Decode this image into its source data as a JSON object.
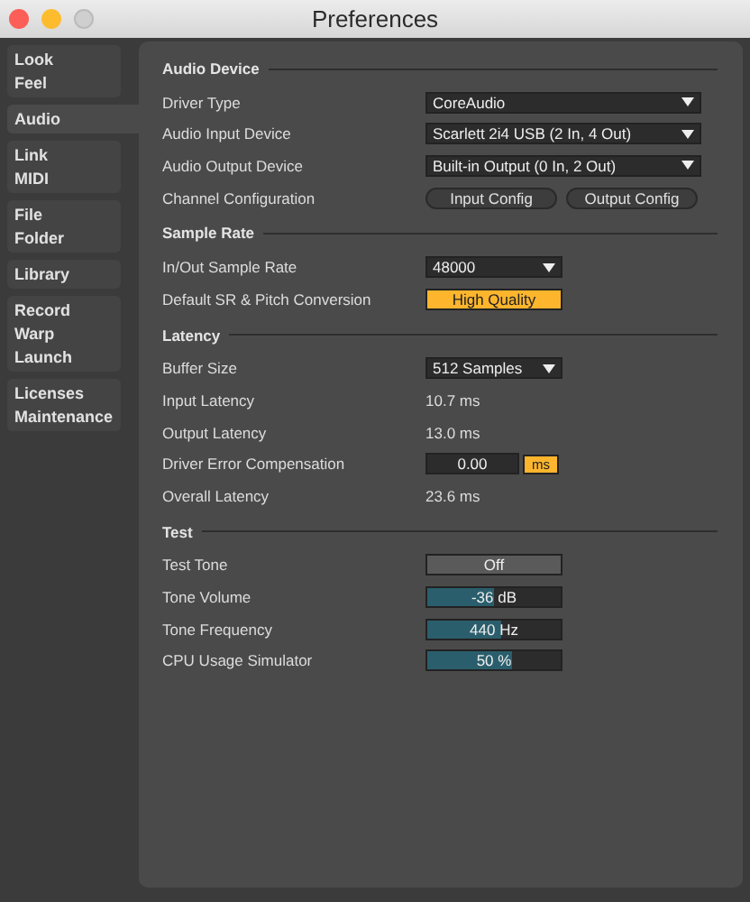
{
  "window": {
    "title": "Preferences"
  },
  "sidebar": {
    "groups": [
      {
        "items": [
          "Look",
          "Feel"
        ],
        "selected": false
      },
      {
        "items": [
          "Audio"
        ],
        "selected": true
      },
      {
        "items": [
          "Link",
          "MIDI"
        ],
        "selected": false
      },
      {
        "items": [
          "File",
          "Folder"
        ],
        "selected": false
      },
      {
        "items": [
          "Library"
        ],
        "selected": false
      },
      {
        "items": [
          "Record",
          "Warp",
          "Launch"
        ],
        "selected": false
      },
      {
        "items": [
          "Licenses",
          "Maintenance"
        ],
        "selected": false
      }
    ]
  },
  "sections": [
    {
      "title": "Audio Device",
      "rows": [
        {
          "kind": "dropdown",
          "label": "Driver Type",
          "value": "CoreAudio",
          "wide": true
        },
        {
          "kind": "dropdown",
          "label": "Audio Input Device",
          "value": "Scarlett 2i4 USB (2 In, 4 Out)",
          "wide": true
        },
        {
          "kind": "dropdown",
          "label": "Audio Output Device",
          "value": "Built-in Output (0 In, 2 Out)",
          "wide": true
        },
        {
          "kind": "buttons",
          "label": "Channel Configuration",
          "buttons": [
            "Input Config",
            "Output Config"
          ]
        }
      ]
    },
    {
      "title": "Sample Rate",
      "rows": [
        {
          "kind": "dropdown",
          "label": "In/Out Sample Rate",
          "value": "48000",
          "wide": false
        },
        {
          "kind": "toggle",
          "label": "Default SR & Pitch Conversion",
          "value": "High Quality",
          "on": true
        }
      ]
    },
    {
      "title": "Latency",
      "rows": [
        {
          "kind": "dropdown",
          "label": "Buffer Size",
          "value": "512 Samples",
          "wide": false
        },
        {
          "kind": "text",
          "label": "Input Latency",
          "value": "10.7 ms"
        },
        {
          "kind": "text",
          "label": "Output Latency",
          "value": "13.0 ms"
        },
        {
          "kind": "number",
          "label": "Driver Error Compensation",
          "value": "0.00",
          "unit": "ms"
        },
        {
          "kind": "text",
          "label": "Overall Latency",
          "value": "23.6 ms"
        }
      ]
    },
    {
      "title": "Test",
      "rows": [
        {
          "kind": "toggle",
          "label": "Test Tone",
          "value": "Off",
          "on": false
        },
        {
          "kind": "slider",
          "label": "Tone Volume",
          "value": "-36 dB",
          "level": 0.5
        },
        {
          "kind": "slider",
          "label": "Tone Frequency",
          "value": "440 Hz",
          "level": 0.55
        },
        {
          "kind": "slider",
          "label": "CPU Usage Simulator",
          "value": "50 %",
          "level": 0.63
        }
      ]
    }
  ]
}
